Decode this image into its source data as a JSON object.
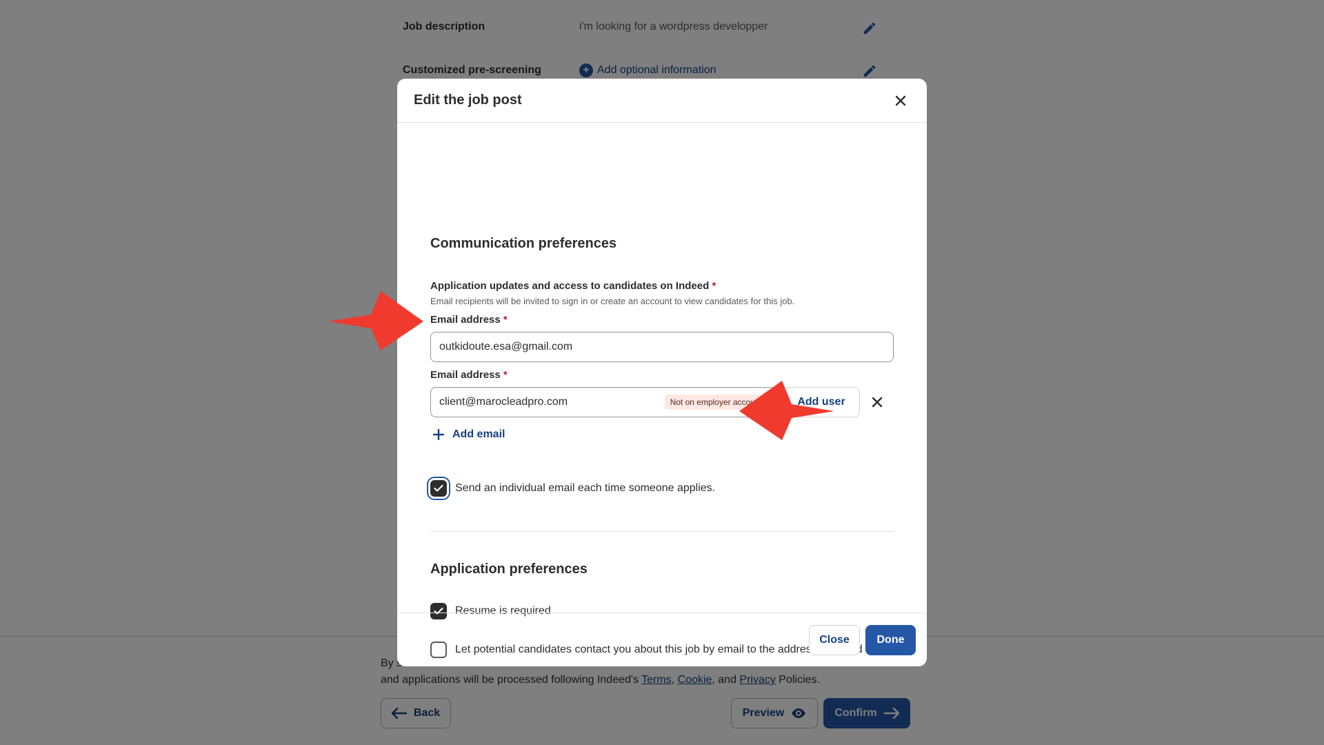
{
  "background": {
    "rows": [
      {
        "label": "Job description",
        "value": "i'm looking for a wordpress developper"
      },
      {
        "label": "Customized pre-screening",
        "action": "Add optional information"
      }
    ],
    "footer": {
      "legal_prefix": "By s",
      "legal_line2_prefix": "and applications will be processed following Indeed's ",
      "terms": "Terms",
      "comma": ", ",
      "cookie": "Cookie",
      "and": ", and ",
      "privacy": "Privacy",
      "suffix": " Policies.",
      "back": "Back",
      "preview": "Preview",
      "confirm": "Confirm"
    }
  },
  "modal": {
    "title": "Edit the job post",
    "communication": {
      "title": "Communication preferences",
      "updates_label": "Application updates and access to candidates on Indeed",
      "required_mark": "*",
      "helper": "Email recipients will be invited to sign in or create an account to view candidates for this job.",
      "emails": [
        {
          "label": "Email address",
          "value": "outkidoute.esa@gmail.com"
        },
        {
          "label": "Email address",
          "value": "client@marocleadpro.com",
          "badge": "Not on employer account"
        }
      ],
      "add_user": "Add user",
      "add_email": "Add email",
      "individual_email": {
        "label": "Send an individual email each time someone applies.",
        "checked": true
      }
    },
    "application": {
      "title": "Application preferences",
      "resume": {
        "label": "Resume is required",
        "checked": true
      },
      "contact": {
        "label": "Let potential candidates contact you about this job by email to the address provided",
        "checked": false
      }
    },
    "close": "Close",
    "done": "Done"
  },
  "colors": {
    "accent": "#2557a7",
    "link": "#164081",
    "annotation_arrow": "#f03a2e"
  }
}
